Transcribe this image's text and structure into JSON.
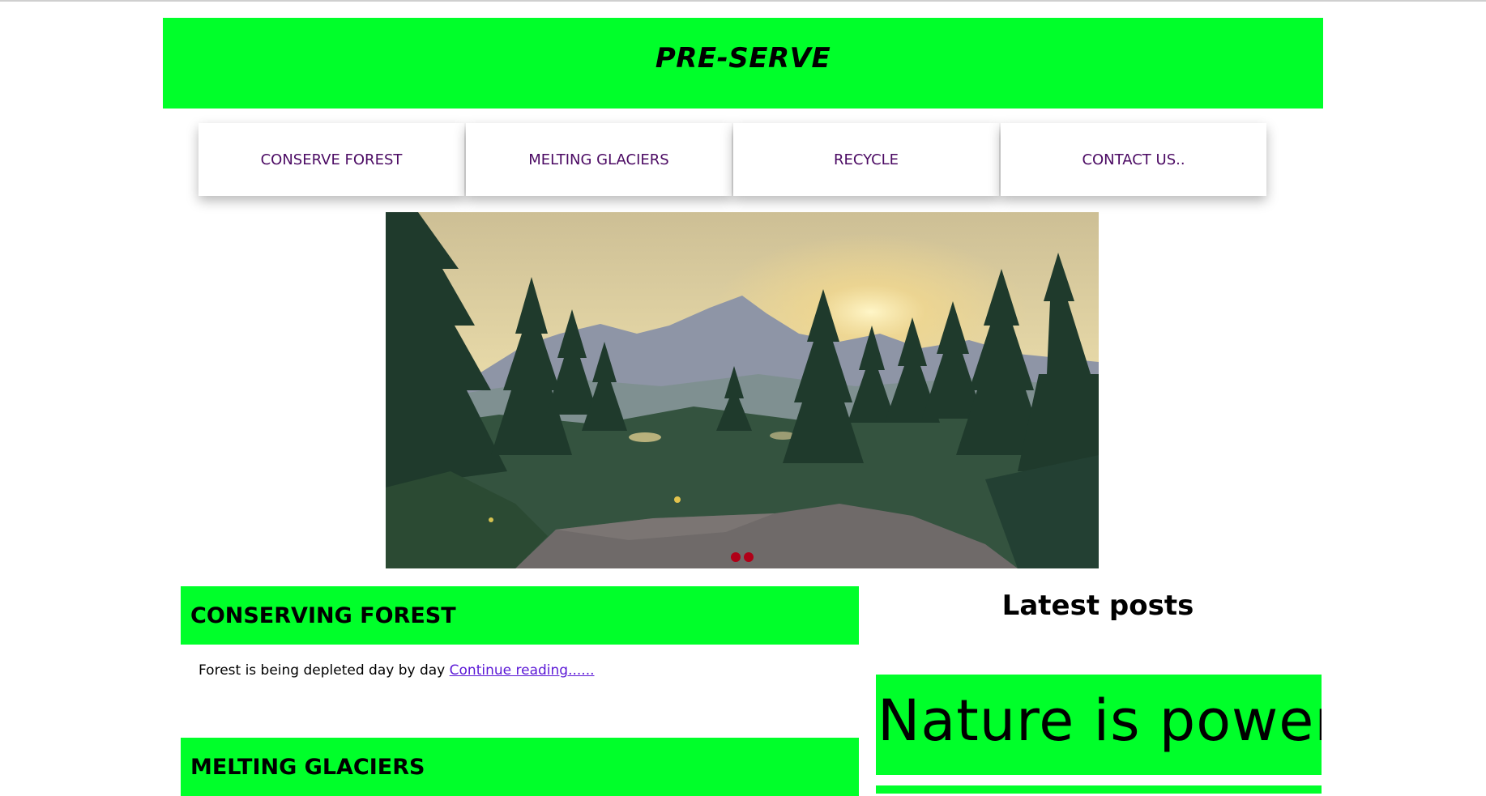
{
  "site": {
    "title": "PRE-SERVE"
  },
  "nav": {
    "items": [
      "CONSERVE FOREST",
      "MELTING GLACIERS",
      "RECYCLE",
      "CONTACT US.."
    ]
  },
  "colors": {
    "brand_green": "#00ff2a",
    "nav_text": "#4b0a63",
    "link": "#5b18d6",
    "slider_dot": "#b00018"
  },
  "hero": {
    "image": "forest sunset landscape with pine trees and mountains"
  },
  "posts": [
    {
      "title": "CONSERVING FOREST",
      "excerpt": "Forest is being depleted day by day",
      "link_label": "Continue reading......"
    },
    {
      "title": "MELTING GLACIERS"
    }
  ],
  "sidebar": {
    "heading": "Latest posts",
    "cards": [
      {
        "text": "Nature is power"
      }
    ]
  }
}
